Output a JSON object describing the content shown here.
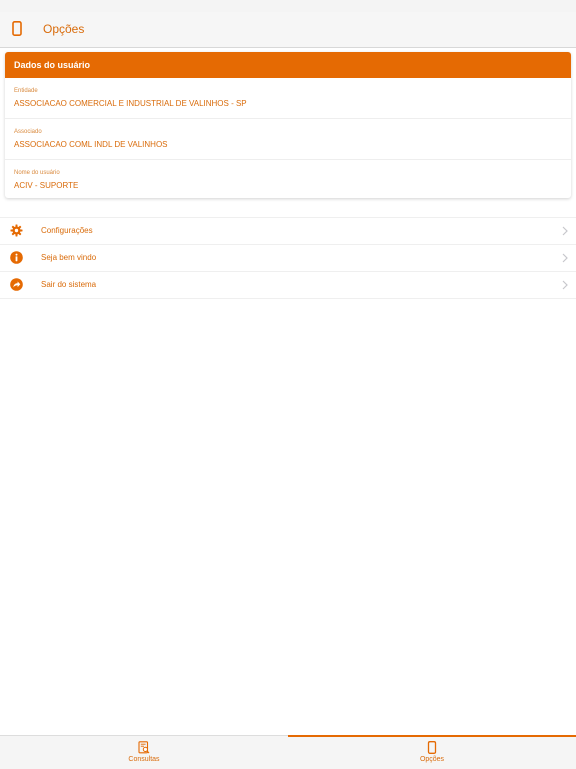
{
  "colors": {
    "accent": "#e56a03",
    "text": "#d96b0a",
    "bg": "#ffffff"
  },
  "navbar": {
    "title": "Opções",
    "icon": "phone-icon"
  },
  "user_card": {
    "header": "Dados do usuário",
    "fields": [
      {
        "label": "Entidade",
        "value": "ASSOCIACAO COMERCIAL E INDUSTRIAL DE VALINHOS - SP"
      },
      {
        "label": "Associado",
        "value": "ASSOCIACAO COML INDL DE VALINHOS"
      },
      {
        "label": "Nome do usuário",
        "value": "ACIV - SUPORTE"
      }
    ]
  },
  "menu": {
    "items": [
      {
        "label": "Configurações",
        "icon": "gear-icon"
      },
      {
        "label": "Seja bem vindo",
        "icon": "info-icon"
      },
      {
        "label": "Sair do sistema",
        "icon": "logout-icon"
      }
    ]
  },
  "tabbar": {
    "tabs": [
      {
        "label": "Consultas",
        "icon": "search-document-icon",
        "active": false
      },
      {
        "label": "Opções",
        "icon": "phone-icon",
        "active": true
      }
    ]
  }
}
